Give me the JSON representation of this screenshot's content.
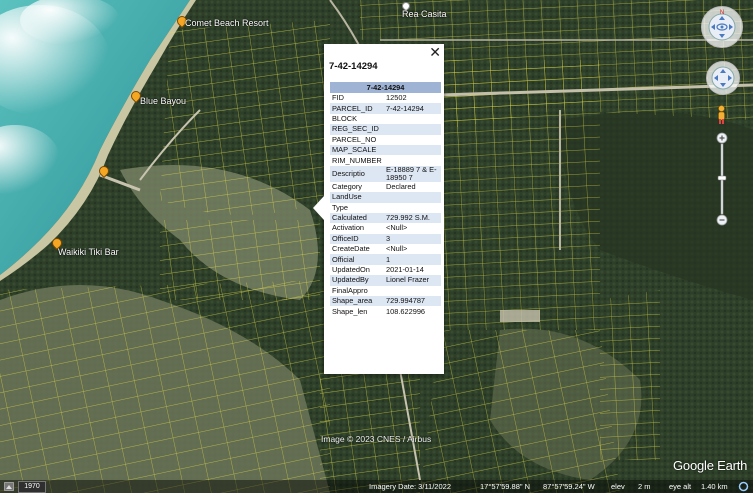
{
  "places": [
    {
      "id": "comet",
      "label": "Comet Beach Resort"
    },
    {
      "id": "rea",
      "label": "Rea Casita"
    },
    {
      "id": "bayou",
      "label": "Blue Bayou"
    },
    {
      "id": "tiki",
      "label": "Waikiki Tiki Bar"
    }
  ],
  "popup": {
    "title": "7-42-14294",
    "table_header": "7-42-14294",
    "close_label": "✕",
    "rows": [
      {
        "k": "FID",
        "v": "12502"
      },
      {
        "k": "PARCEL_ID",
        "v": "7-42-14294"
      },
      {
        "k": "BLOCK",
        "v": ""
      },
      {
        "k": "REG_SEC_ID",
        "v": ""
      },
      {
        "k": "PARCEL_NO",
        "v": ""
      },
      {
        "k": "MAP_SCALE",
        "v": ""
      },
      {
        "k": "RIM_NUMBER",
        "v": ""
      },
      {
        "k": "Descriptio",
        "v": "E-18889 7 & E-18950 7"
      },
      {
        "k": "Category",
        "v": "Declared"
      },
      {
        "k": "LandUse",
        "v": ""
      },
      {
        "k": "Type",
        "v": ""
      },
      {
        "k": "Calculated",
        "v": "729.992 S.M."
      },
      {
        "k": "Activation",
        "v": "<Null>"
      },
      {
        "k": "OfficeID",
        "v": "3"
      },
      {
        "k": "CreateDate",
        "v": "<Null>"
      },
      {
        "k": "Official",
        "v": "1"
      },
      {
        "k": "UpdatedOn",
        "v": "2021-01-14"
      },
      {
        "k": "UpdatedBy",
        "v": "Lionel Frazer"
      },
      {
        "k": "FinalAppro",
        "v": ""
      },
      {
        "k": "Shape_area",
        "v": "729.994787"
      },
      {
        "k": "Shape_len",
        "v": "108.622996"
      }
    ]
  },
  "footer": {
    "year": "1970",
    "imagery_date": "Imagery Date: 3/11/2022",
    "lat": "17°57'59.88\" N",
    "lon": "87°57'59.24\" W",
    "elev": "elev",
    "elev_val": "2 m",
    "eye_alt": "eye alt",
    "eye_alt_val": "1.40 km"
  },
  "copyright": "Image © 2023 CNES / Airbus",
  "logo": "Google Earth",
  "colors": {
    "sea": "#3fa8a8",
    "parcel_lines": "#e8e04a",
    "popup_header": "#9fb4d4",
    "pin": "#f5a623"
  }
}
